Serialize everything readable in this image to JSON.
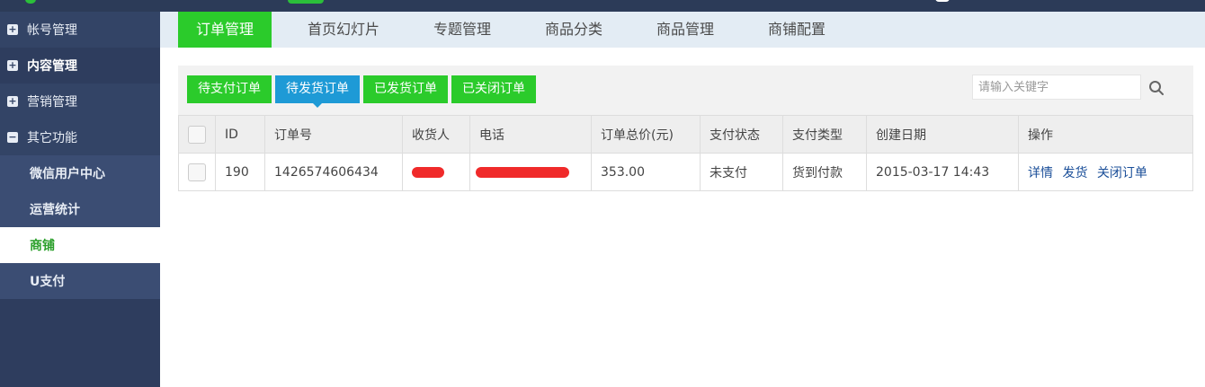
{
  "sidebar": {
    "items": [
      {
        "label": "帐号管理",
        "icon": "plus-square-icon",
        "type": "group"
      },
      {
        "label": "内容管理",
        "icon": "plus-square-icon",
        "type": "group"
      },
      {
        "label": "营销管理",
        "icon": "plus-square-icon",
        "type": "group"
      },
      {
        "label": "其它功能",
        "icon": "minus-square-icon",
        "type": "group"
      },
      {
        "label": "微信用户中心",
        "type": "sub"
      },
      {
        "label": "运营统计",
        "type": "sub"
      },
      {
        "label": "商铺",
        "type": "sub",
        "selected": true
      },
      {
        "label": "U支付",
        "type": "sub"
      }
    ]
  },
  "tabs": [
    "订单管理",
    "首页幻灯片",
    "专题管理",
    "商品分类",
    "商品管理",
    "商铺配置"
  ],
  "active_tab": "订单管理",
  "filters": {
    "buttons": [
      "待支付订单",
      "待发货订单",
      "已发货订单",
      "已关闭订单"
    ],
    "active": "待发货订单"
  },
  "search": {
    "placeholder": "请输入关键字",
    "icon": "search-icon"
  },
  "table": {
    "headers": [
      "ID",
      "订单号",
      "收货人",
      "电话",
      "订单总价(元)",
      "支付状态",
      "支付类型",
      "创建日期",
      "操作"
    ],
    "rows": [
      {
        "id": "190",
        "order_no": "1426574606434",
        "receiver": "",
        "phone": "",
        "total": "353.00",
        "pay_status": "未支付",
        "pay_type": "货到付款",
        "created": "2015-03-17 14:43",
        "actions": [
          "详情",
          "发货",
          "关闭订单"
        ]
      }
    ]
  },
  "colors": {
    "accent_green": "#2bcb2b",
    "accent_blue": "#1e9ad6",
    "sidebar_bg": "#2e3d5e",
    "redaction": "#f02a2a"
  }
}
